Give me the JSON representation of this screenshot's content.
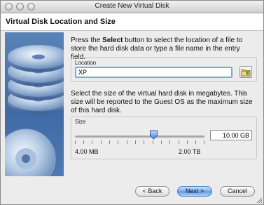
{
  "window": {
    "title": "Create New Virtual Disk"
  },
  "header": {
    "title": "Virtual Disk Location and Size"
  },
  "location": {
    "intro_prefix": "Press the ",
    "intro_bold": "Select",
    "intro_suffix": " button to select the location of a file to store the hard disk data or type a file name in the entry field.",
    "label": "Location",
    "value": "XP",
    "folder_icon": "folder-icon"
  },
  "size": {
    "intro": "Select the size of the virtual hard disk in megabytes. This size will be reported to the Guest OS as the maximum size of this hard disk.",
    "label": "Size",
    "value": "10.00 GB",
    "min_label": "4.00 MB",
    "max_label": "2.00 TB",
    "slider_fraction": 0.61
  },
  "buttons": {
    "back": "< Back",
    "next": "Next >",
    "cancel": "Cancel"
  }
}
